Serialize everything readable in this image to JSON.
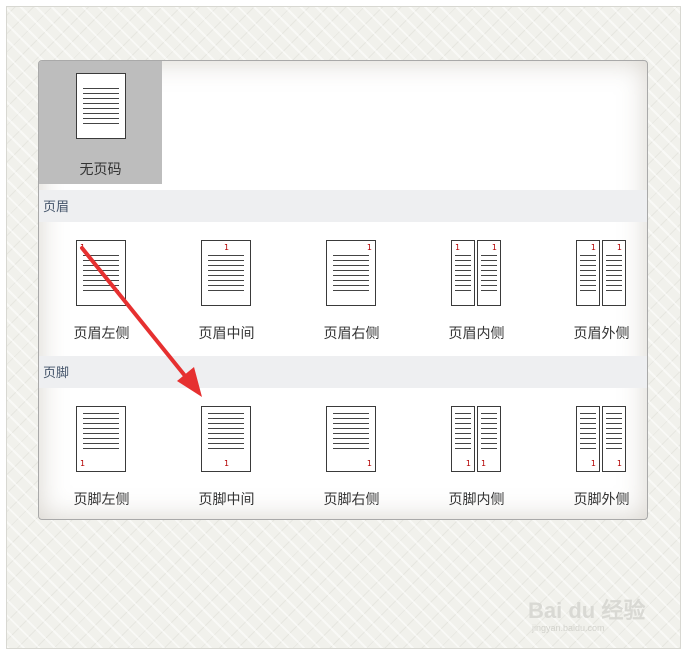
{
  "none_item": {
    "label": "无页码"
  },
  "sections": {
    "header": "页眉",
    "footer": "页脚"
  },
  "header_items": [
    {
      "label": "页眉左侧",
      "number": "1"
    },
    {
      "label": "页眉中间",
      "number": "1"
    },
    {
      "label": "页眉右侧",
      "number": "1"
    },
    {
      "label": "页眉内侧",
      "number": "1"
    },
    {
      "label": "页眉外侧",
      "number": "1"
    }
  ],
  "footer_items": [
    {
      "label": "页脚左侧",
      "number": "1"
    },
    {
      "label": "页脚中间",
      "number": "1"
    },
    {
      "label": "页脚右侧",
      "number": "1"
    },
    {
      "label": "页脚内侧",
      "number": "1"
    },
    {
      "label": "页脚外侧",
      "number": "1"
    }
  ],
  "watermark": {
    "main": "Bai du 经验",
    "sub": "jingyan.baidu.com"
  },
  "colors": {
    "selected_bg": "#bdbdbd",
    "section_bg": "#eeeff1",
    "arrow": "#e63030",
    "page_number": "#b30000"
  }
}
